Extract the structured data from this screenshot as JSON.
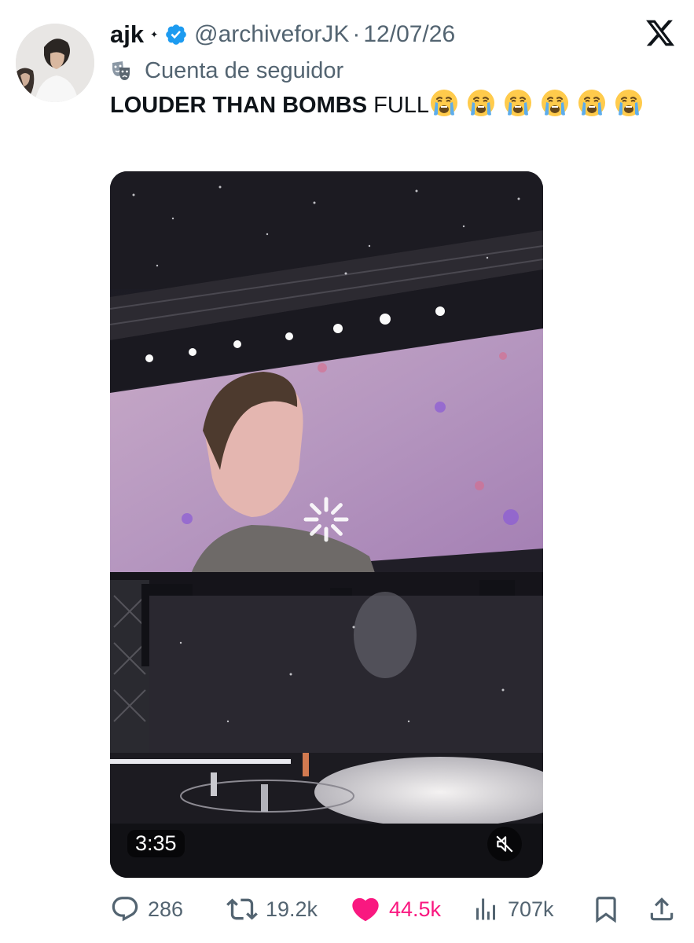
{
  "author": {
    "display_name": "ajk",
    "handle": "@archiveforJK",
    "date": "12/07/26",
    "label": "Cuenta de seguidor"
  },
  "tweet": {
    "text_bold": "LOUDER THAN BOMBS",
    "text_rest": "FULL",
    "emoji": "loudly-crying-face",
    "emoji_count": 6
  },
  "media": {
    "type": "video",
    "duration": "3:35",
    "muted": true
  },
  "actions": {
    "replies": "286",
    "reposts": "19.2k",
    "likes": "44.5k",
    "views": "707k",
    "liked": true
  },
  "colors": {
    "verified": "#1d9bf0",
    "like": "#f91880",
    "secondary_text": "#536471"
  },
  "icons": [
    "verified-badge-icon",
    "x-logo-icon",
    "theater-masks-icon",
    "reply-icon",
    "repost-icon",
    "heart-icon",
    "views-icon",
    "bookmark-icon",
    "share-icon",
    "mute-icon",
    "loading-spinner-icon"
  ]
}
